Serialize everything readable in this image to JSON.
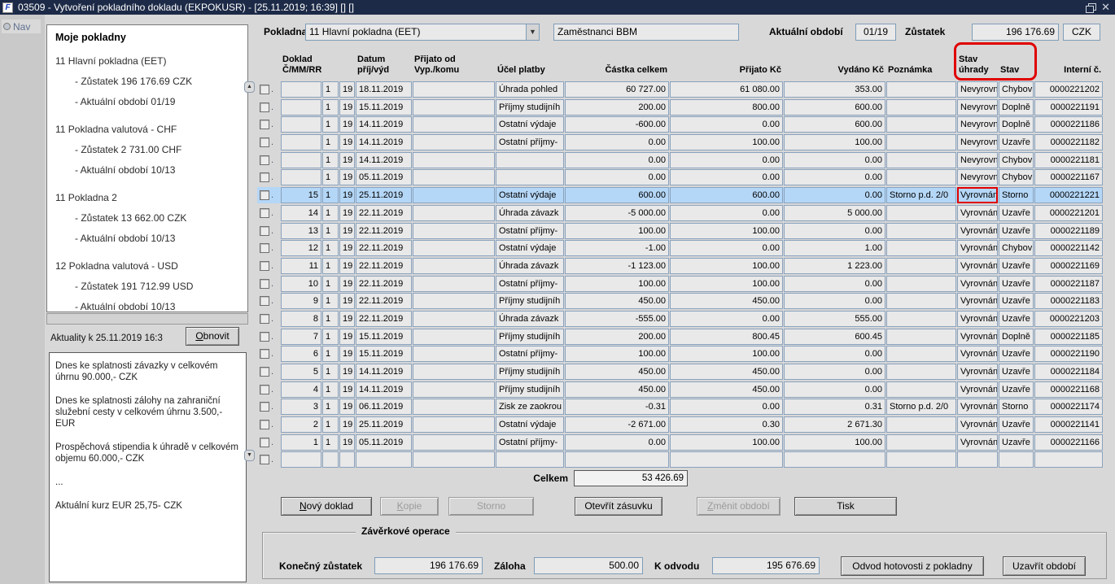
{
  "colors": {
    "titlebar": "#1c2a47",
    "selected_row": "#b5d7f7",
    "annotation": "#e00000",
    "cell_border": "#8aa2bd"
  },
  "window": {
    "title": "03509 - Vytvoření pokladního dokladu (EKPOKUSR) - [25.11.2019; 16:39]  []  []"
  },
  "nav": {
    "label": "Nav"
  },
  "sidebar": {
    "title": "Moje pokladny",
    "cashboxes": [
      {
        "name": "11 Hlavní pokladna (EET)",
        "details": [
          "- Zůstatek 196 176.69 CZK",
          "- Aktuální období 01/19"
        ]
      },
      {
        "name": "11 Pokladna valutová - CHF",
        "details": [
          "- Zůstatek 2 731.00 CHF",
          "- Aktuální období 10/13"
        ]
      },
      {
        "name": "11 Pokladna 2",
        "details": [
          "- Zůstatek 13 662.00 CZK",
          "- Aktuální období 10/13"
        ]
      },
      {
        "name": "12 Pokladna valutová - USD",
        "details": [
          "- Zůstatek 191 712.99 USD",
          "- Aktuální období 10/13"
        ]
      }
    ],
    "news": {
      "label": "Aktuality k 25.11.2019 16:3",
      "refresh_button": "Obnovit",
      "items": [
        "Dnes ke splatnosti závazky v celkovém úhrnu 90.000,- CZK",
        "Dnes ke splatnosti zálohy na zahraniční služební cesty v celkovém úhrnu 3.500,- EUR",
        "Prospěchová stipendia k úhradě v celkovém objemu 60.000,- CZK",
        "...",
        "Aktuální kurz EUR 25,75- CZK"
      ]
    }
  },
  "topbar": {
    "pokladna_label": "Pokladna",
    "pokladna_value": "11 Hlavní pokladna (EET)",
    "owner_value": "Zaměstnanci BBM",
    "period_label": "Aktuální období",
    "period_value": "01/19",
    "balance_label": "Zůstatek",
    "balance_value": "196 176.69",
    "currency": "CZK"
  },
  "table": {
    "headers": {
      "doklad_line1": "Doklad",
      "doklad_line2": "Č/MM/RR",
      "datum_line1": "Datum",
      "datum_line2": "příj/výd",
      "prijato_od_line1": "Přijato od",
      "prijato_od_line2": "Vyp./komu",
      "ucel": "Účel platby",
      "castka": "Částka celkem",
      "prijato_kc": "Přijato Kč",
      "vydano_kc": "Vydáno Kč",
      "poznamka": "Poznámka",
      "stav_uhrady_line1": "Stav",
      "stav_uhrady_line2": "úhrady",
      "stav": "Stav",
      "interni": "Interní č."
    },
    "rows": [
      {
        "cells": [
          "",
          "1",
          "19",
          "18.11.2019",
          "",
          "Úhrada pohled",
          "60 727.00",
          "61 080.00",
          "353.00",
          "",
          "Nevyrovn",
          "Chybov",
          "0000221202"
        ]
      },
      {
        "cells": [
          "",
          "1",
          "19",
          "15.11.2019",
          "",
          "Příjmy studijníh",
          "200.00",
          "800.00",
          "600.00",
          "",
          "Nevyrovn",
          "Doplně",
          "0000221191"
        ]
      },
      {
        "cells": [
          "",
          "1",
          "19",
          "14.11.2019",
          "",
          "Ostatní výdaje",
          "-600.00",
          "0.00",
          "600.00",
          "",
          "Nevyrovn",
          "Doplně",
          "0000221186"
        ]
      },
      {
        "cells": [
          "",
          "1",
          "19",
          "14.11.2019",
          "",
          "Ostatní příjmy-",
          "0.00",
          "100.00",
          "100.00",
          "",
          "Nevyrovn",
          "Uzavře",
          "0000221182"
        ]
      },
      {
        "cells": [
          "",
          "1",
          "19",
          "14.11.2019",
          "",
          "",
          "0.00",
          "0.00",
          "0.00",
          "",
          "Nevyrovn",
          "Chybov",
          "0000221181"
        ]
      },
      {
        "cells": [
          "",
          "1",
          "19",
          "05.11.2019",
          "",
          "",
          "0.00",
          "0.00",
          "0.00",
          "",
          "Nevyrovn",
          "Chybov",
          "0000221167"
        ]
      },
      {
        "selected": true,
        "flag": true,
        "cells": [
          "15",
          "1",
          "19",
          "25.11.2019",
          "",
          "Ostatní výdaje",
          "600.00",
          "600.00",
          "0.00",
          "Storno p.d. 2/0",
          "Vyrovnán",
          "Storno",
          "0000221221"
        ]
      },
      {
        "cells": [
          "14",
          "1",
          "19",
          "22.11.2019",
          "",
          "Úhrada závazk",
          "-5 000.00",
          "0.00",
          "5 000.00",
          "",
          "Vyrovnán",
          "Uzavře",
          "0000221201"
        ]
      },
      {
        "cells": [
          "13",
          "1",
          "19",
          "22.11.2019",
          "",
          "Ostatní příjmy-",
          "100.00",
          "100.00",
          "0.00",
          "",
          "Vyrovnán",
          "Uzavře",
          "0000221189"
        ]
      },
      {
        "cells": [
          "12",
          "1",
          "19",
          "22.11.2019",
          "",
          "Ostatní výdaje",
          "-1.00",
          "0.00",
          "1.00",
          "",
          "Vyrovnán",
          "Chybov",
          "0000221142"
        ]
      },
      {
        "cells": [
          "11",
          "1",
          "19",
          "22.11.2019",
          "",
          "Úhrada závazk",
          "-1 123.00",
          "100.00",
          "1 223.00",
          "",
          "Vyrovnán",
          "Uzavře",
          "0000221169"
        ]
      },
      {
        "cells": [
          "10",
          "1",
          "19",
          "22.11.2019",
          "",
          "Ostatní příjmy-",
          "100.00",
          "100.00",
          "0.00",
          "",
          "Vyrovnán",
          "Uzavře",
          "0000221187"
        ]
      },
      {
        "cells": [
          "9",
          "1",
          "19",
          "22.11.2019",
          "",
          "Příjmy studijníh",
          "450.00",
          "450.00",
          "0.00",
          "",
          "Vyrovnán",
          "Uzavře",
          "0000221183"
        ]
      },
      {
        "cells": [
          "8",
          "1",
          "19",
          "22.11.2019",
          "",
          "Úhrada závazk",
          "-555.00",
          "0.00",
          "555.00",
          "",
          "Vyrovnán",
          "Uzavře",
          "0000221203"
        ]
      },
      {
        "cells": [
          "7",
          "1",
          "19",
          "15.11.2019",
          "",
          "Příjmy studijníh",
          "200.00",
          "800.45",
          "600.45",
          "",
          "Vyrovnán",
          "Doplně",
          "0000221185"
        ]
      },
      {
        "cells": [
          "6",
          "1",
          "19",
          "15.11.2019",
          "",
          "Ostatní příjmy-",
          "100.00",
          "100.00",
          "0.00",
          "",
          "Vyrovnán",
          "Uzavře",
          "0000221190"
        ]
      },
      {
        "cells": [
          "5",
          "1",
          "19",
          "14.11.2019",
          "",
          "Příjmy studijníh",
          "450.00",
          "450.00",
          "0.00",
          "",
          "Vyrovnán",
          "Uzavře",
          "0000221184"
        ]
      },
      {
        "cells": [
          "4",
          "1",
          "19",
          "14.11.2019",
          "",
          "Příjmy studijníh",
          "450.00",
          "450.00",
          "0.00",
          "",
          "Vyrovnán",
          "Uzavře",
          "0000221168"
        ]
      },
      {
        "cells": [
          "3",
          "1",
          "19",
          "06.11.2019",
          "",
          "Zisk ze zaokrou",
          "-0.31",
          "0.00",
          "0.31",
          "Storno p.d. 2/0",
          "Vyrovnán",
          "Storno",
          "0000221174"
        ]
      },
      {
        "cells": [
          "2",
          "1",
          "19",
          "25.11.2019",
          "",
          "Ostatní výdaje",
          "-2 671.00",
          "0.30",
          "2 671.30",
          "",
          "Vyrovnán",
          "Uzavře",
          "0000221141"
        ]
      },
      {
        "cells": [
          "1",
          "1",
          "19",
          "05.11.2019",
          "",
          "Ostatní příjmy-",
          "0.00",
          "100.00",
          "100.00",
          "",
          "Vyrovnán",
          "Uzavře",
          "0000221166"
        ]
      },
      {
        "cells": [
          "",
          "",
          "",
          "",
          "",
          "",
          "",
          "",
          "",
          "",
          "",
          "",
          ""
        ]
      }
    ]
  },
  "totals": {
    "celkem_label": "Celkem",
    "celkem_value": "53 426.69"
  },
  "actions": {
    "novy_doklad": "Nový doklad",
    "kopie": "Kopie",
    "storno": "Storno",
    "otevrit_zasuvku": "Otevřít zásuvku",
    "zmenit_obdobi": "Změnit období",
    "tisk": "Tisk"
  },
  "closing": {
    "legend": "Závěrkové operace",
    "konecny_zustatek_label": "Konečný zůstatek",
    "konecny_zustatek_value": "196 176.69",
    "zaloha_label": "Záloha",
    "zaloha_value": "500.00",
    "k_odvodu_label": "K odvodu",
    "k_odvodu_value": "195 676.69",
    "odvod_button": "Odvod hotovosti z pokladny",
    "uzavrit_button": "Uzavřít období"
  }
}
